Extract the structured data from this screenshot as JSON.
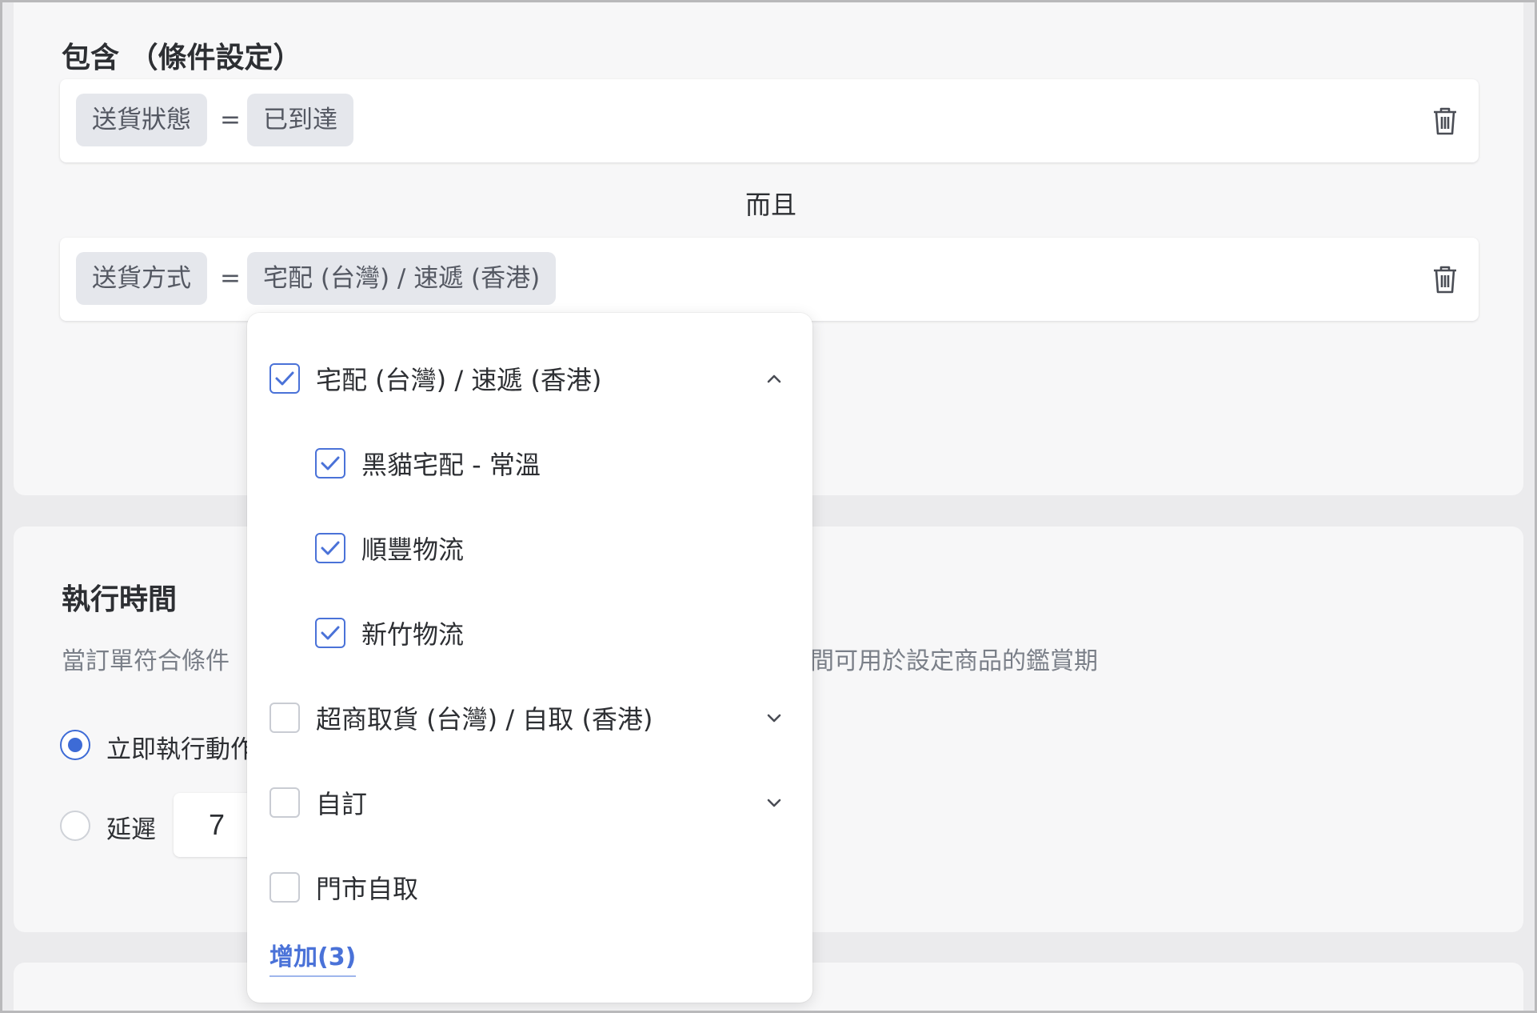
{
  "include_section": {
    "title": "包含 （條件設定）",
    "conditions": [
      {
        "field": "送貨狀態",
        "operator": "=",
        "value": "已到達"
      },
      {
        "field": "送貨方式",
        "operator": "=",
        "value": "宅配 (台灣) / 速遞 (香港)"
      }
    ],
    "connector": "而且"
  },
  "execution_section": {
    "title": "執行時間",
    "description_left": "當訂單符合條件",
    "description_right": "間可用於設定商品的鑑賞期",
    "options": [
      {
        "label": "立即執行動作",
        "selected": true
      },
      {
        "label": "延遲",
        "selected": false
      }
    ],
    "delay_value": "7"
  },
  "dropdown": {
    "groups": [
      {
        "label": "宅配 (台灣) / 速遞 (香港)",
        "checked": true,
        "expanded": true,
        "children": [
          {
            "label": "黑貓宅配 - 常溫",
            "checked": true
          },
          {
            "label": "順豐物流",
            "checked": true
          },
          {
            "label": "新竹物流",
            "checked": true
          }
        ]
      },
      {
        "label": "超商取貨 (台灣) / 自取 (香港)",
        "checked": false,
        "expanded": false
      },
      {
        "label": "自訂",
        "checked": false,
        "expanded": false
      },
      {
        "label": "門市自取",
        "checked": false,
        "expanded": false
      }
    ],
    "add_button": "增加(3)"
  },
  "colors": {
    "accent": "#4a72d8",
    "tag_bg": "#e5e7ec",
    "card_bg": "#f7f7f8",
    "page_bg": "#ebebed"
  },
  "icons": [
    "trash-icon",
    "checkmark-icon",
    "chevron-up-icon",
    "chevron-down-icon"
  ]
}
